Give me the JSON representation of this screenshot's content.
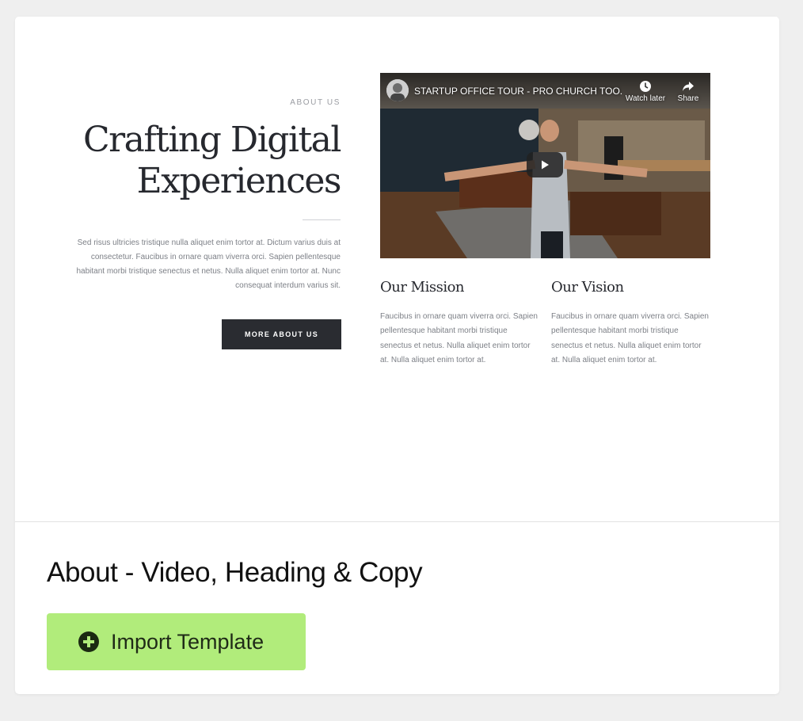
{
  "preview": {
    "eyebrow": "ABOUT US",
    "heading_line1": "Crafting Digital",
    "heading_line2": "Experiences",
    "body": "Sed risus ultricies tristique nulla aliquet enim tortor at. Dictum varius duis at consectetur. Faucibus in ornare quam viverra orci. Sapien pellentesque habitant morbi tristique senectus et netus. Nulla aliquet enim tortor at. Nunc consequat interdum varius sit.",
    "more_button": "MORE ABOUT US",
    "video": {
      "title": "STARTUP OFFICE TOUR - PRO CHURCH TOO...",
      "watch_later": "Watch later",
      "share": "Share",
      "icons": [
        "channel-avatar",
        "clock-icon",
        "share-icon",
        "play-icon"
      ]
    },
    "mission": {
      "title": "Our Mission",
      "text": "Faucibus in ornare quam viverra orci. Sapien pellentesque habitant morbi tristique senectus et netus. Nulla aliquet enim tortor at. Nulla aliquet enim tortor at."
    },
    "vision": {
      "title": "Our Vision",
      "text": "Faucibus in ornare quam viverra orci. Sapien pellentesque habitant morbi tristique senectus et netus. Nulla aliquet enim tortor at. Nulla aliquet enim tortor at."
    }
  },
  "template": {
    "title": "About - Video, Heading & Copy",
    "import_label": "Import Template",
    "import_icon": "plus-circle-icon"
  },
  "colors": {
    "page_bg": "#efefef",
    "card_bg": "#ffffff",
    "import_button_bg": "#b1ec7b",
    "dark_button_bg": "#2a2c31",
    "heading_text": "#26282e"
  }
}
